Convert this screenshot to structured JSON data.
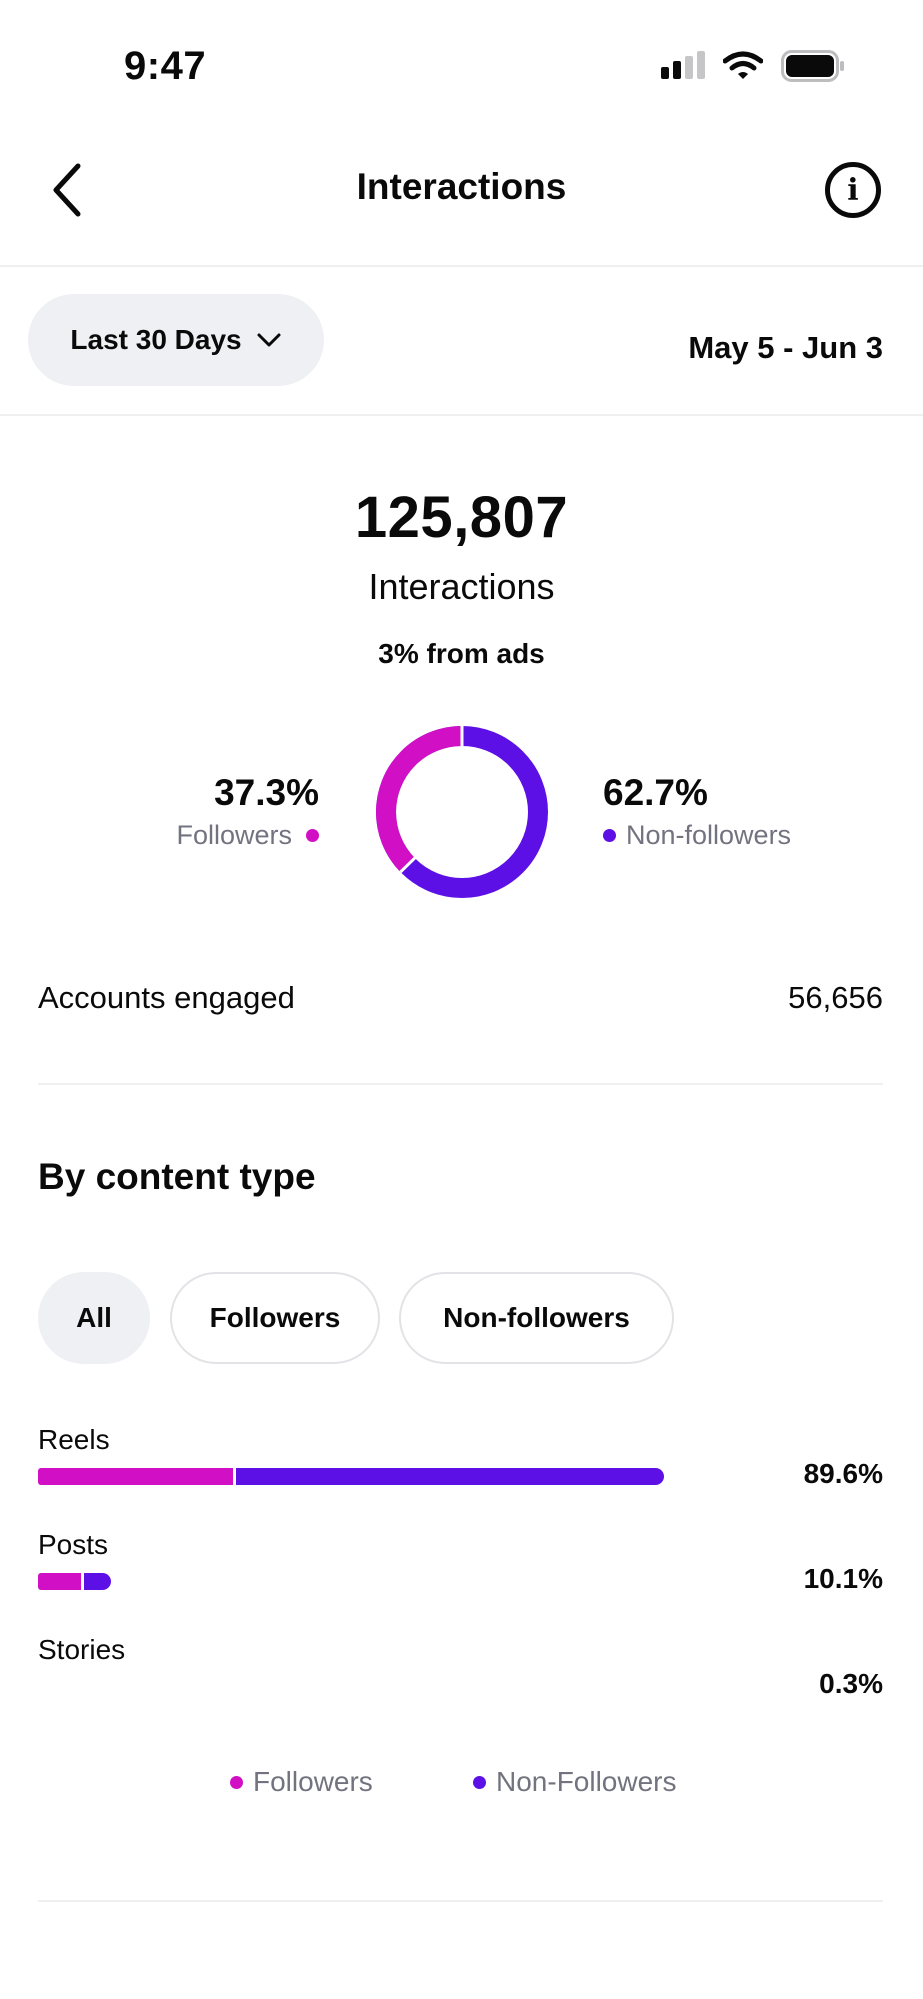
{
  "status_bar": {
    "time": "9:47"
  },
  "header": {
    "title": "Interactions",
    "back_icon": "chevron-left-icon",
    "info_icon": "info-icon"
  },
  "range": {
    "selected": "Last 30 Days",
    "dates": "May 5 - Jun 3"
  },
  "summary": {
    "total": "125,807",
    "label": "Interactions",
    "ads_note": "3% from ads",
    "followers_pct": "37.3%",
    "followers_label": "Followers",
    "nonfollowers_pct": "62.7%",
    "nonfollowers_label": "Non-followers",
    "followers_fraction": 0.373
  },
  "accounts": {
    "label": "Accounts engaged",
    "value": "56,656"
  },
  "content_type": {
    "title": "By content type",
    "filters": [
      "All",
      "Followers",
      "Non-followers"
    ],
    "selected_filter": "All",
    "rows": [
      {
        "label": "Reels",
        "pct": "89.6%",
        "followers_share": 28.0,
        "nonfollowers_share": 61.6
      },
      {
        "label": "Posts",
        "pct": "10.1%",
        "followers_share": 6.2,
        "nonfollowers_share": 3.9
      },
      {
        "label": "Stories",
        "pct": "0.3%",
        "followers_share": 0.1,
        "nonfollowers_share": 0.2
      }
    ],
    "legend": [
      "Followers",
      "Non-Followers"
    ]
  },
  "colors": {
    "followers": "#d10fc4",
    "nonfollowers": "#5c10e6",
    "pill_bg": "#eff0f4",
    "muted_text": "#737380"
  }
}
